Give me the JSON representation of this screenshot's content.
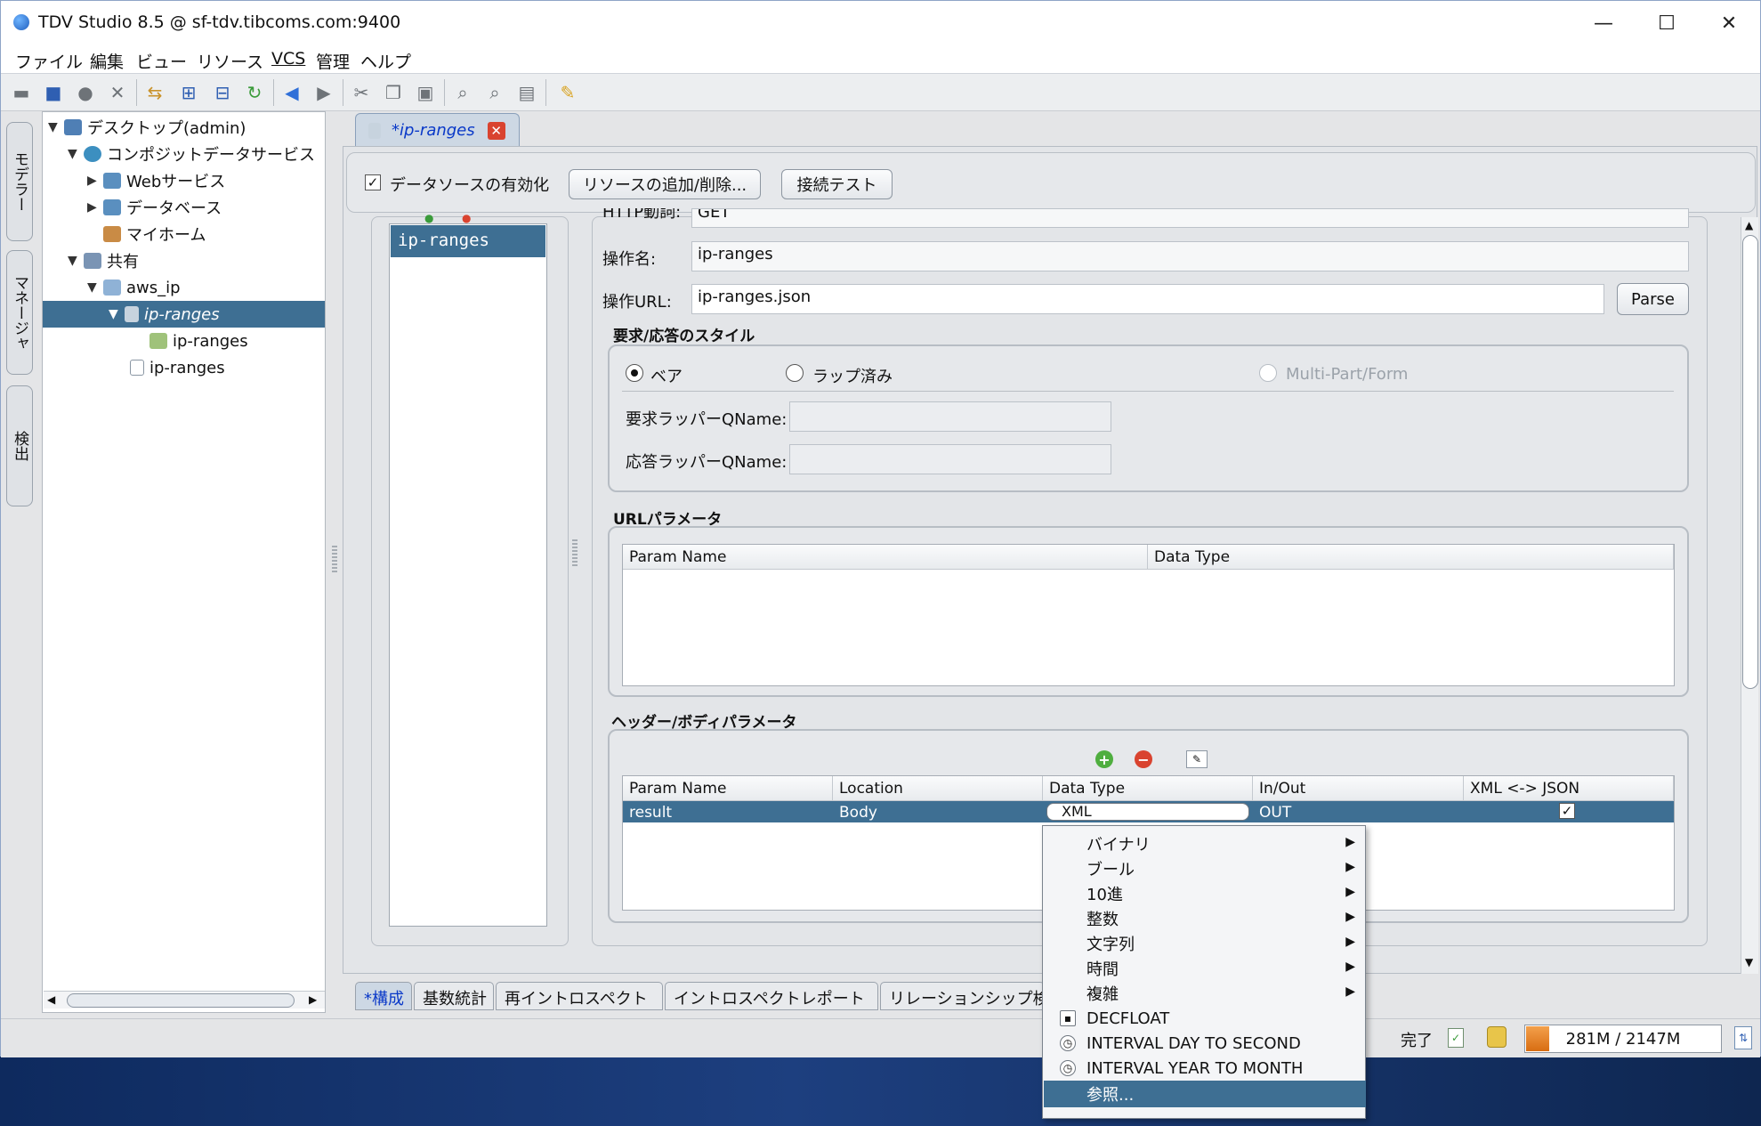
{
  "window": {
    "title": "TDV Studio 8.5 @ sf-tdv.tibcoms.com:9400",
    "minimize": "—",
    "maximize": "☐",
    "close": "✕"
  },
  "menu": [
    "ファイル",
    "編集",
    "ビュー",
    "リソース",
    "VCS",
    "管理",
    "ヘルプ"
  ],
  "side_tabs": [
    "モデラー",
    "マネージャ",
    "検出"
  ],
  "tree": {
    "items": [
      {
        "label": "デスクトップ(admin)"
      },
      {
        "label": "コンポジットデータサービス"
      },
      {
        "label": "Webサービス"
      },
      {
        "label": "データベース"
      },
      {
        "label": "マイホーム"
      },
      {
        "label": "共有"
      },
      {
        "label": "aws_ip"
      },
      {
        "label": "ip-ranges"
      },
      {
        "label": "ip-ranges"
      },
      {
        "label": "ip-ranges"
      }
    ]
  },
  "doc_tab": {
    "label": "*ip-ranges"
  },
  "top_strip": {
    "enable_label": "データソースの有効化",
    "add_remove_button": "リソースの追加/削除...",
    "test_button": "接続テスト"
  },
  "operations": {
    "item": "ip-ranges"
  },
  "form": {
    "http_method_label": "HTTP動詞:",
    "http_method_value": "GET",
    "op_name_label": "操作名:",
    "op_name_value": "ip-ranges",
    "op_url_label": "操作URL:",
    "op_url_value": "ip-ranges.json",
    "parse_button": "Parse"
  },
  "style_group": {
    "title": "要求/応答のスタイル",
    "radio_bare": "ベア",
    "radio_wrapped": "ラップ済み",
    "radio_multipart": "Multi-Part/Form",
    "req_wrapper_label": "要求ラッパーQName:",
    "res_wrapper_label": "応答ラッパーQName:"
  },
  "url_params": {
    "title": "URLパラメータ",
    "col_name": "Param Name",
    "col_type": "Data Type"
  },
  "header_body_params": {
    "title": "ヘッダー/ボディパラメータ",
    "columns": [
      "Param Name",
      "Location",
      "Data Type",
      "In/Out",
      "XML <-> JSON"
    ],
    "row": {
      "name": "result",
      "location": "Body",
      "type": "XML",
      "inout": "OUT",
      "xml_json": "✓"
    }
  },
  "type_menu": {
    "items": [
      {
        "label": "バイナリ",
        "submenu": "▶"
      },
      {
        "label": "ブール",
        "submenu": "▶"
      },
      {
        "label": "10進",
        "submenu": "▶"
      },
      {
        "label": "整数",
        "submenu": "▶"
      },
      {
        "label": "文字列",
        "submenu": "▶"
      },
      {
        "label": "時間",
        "submenu": "▶"
      },
      {
        "label": "複雑",
        "submenu": "▶"
      },
      {
        "label": "DECFLOAT"
      },
      {
        "label": "INTERVAL DAY TO SECOND"
      },
      {
        "label": "INTERVAL YEAR TO MONTH"
      },
      {
        "label": "参照..."
      }
    ]
  },
  "bottom_tabs": [
    "*構成",
    "基数統計",
    "再イントロスペクト",
    "イントロスペクトレポート",
    "リレーションシップ検"
  ],
  "status": {
    "done": "完了",
    "memory": "281M / 2147M"
  },
  "colors": {
    "selection": "#3e6f93",
    "tab_link": "#0a39c8",
    "close_red": "#d9432f"
  }
}
